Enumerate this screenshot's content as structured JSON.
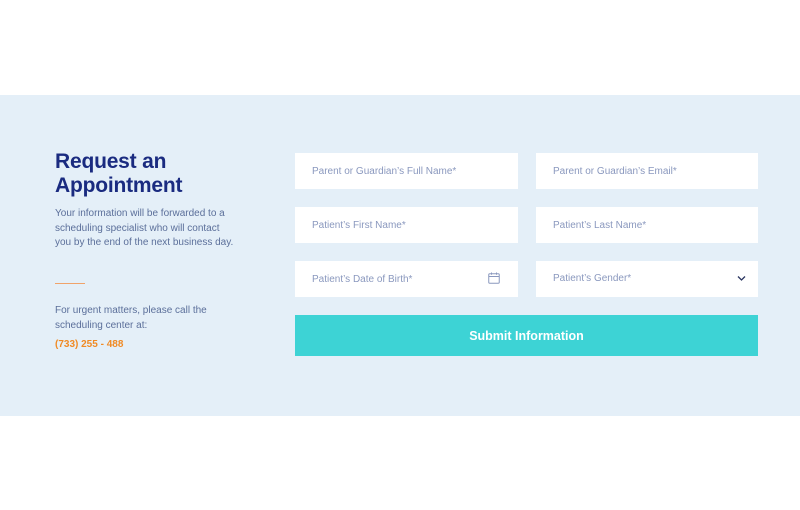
{
  "intro": {
    "title_line1": "Request an",
    "title_line2": "Appointment",
    "description": "Your information will be forwarded to a scheduling specialist who will contact you by the end of the next business day.",
    "urgent_text": "For urgent matters, please call the scheduling center at:",
    "phone": "(733) 255 - 488"
  },
  "form": {
    "guardian_name_placeholder": "Parent or Guardian’s Full Name*",
    "guardian_email_placeholder": "Parent or Guardian’s Email*",
    "patient_first_name_placeholder": "Patient’s First Name*",
    "patient_last_name_placeholder": "Patient’s Last Name*",
    "patient_dob_placeholder": "Patient’s Date of Birth*",
    "patient_gender_label": "Patient’s Gender*",
    "submit_label": "Submit Information"
  },
  "icons": {
    "date_field": "calendar-icon",
    "gender_field": "chevron-down-icon"
  },
  "colors": {
    "band_background": "#e4eff8",
    "title": "#1a2b80",
    "body_text": "#5b6f9a",
    "phone": "#f08a24",
    "divider": "#f0a36a",
    "submit_button": "#3dd3d5",
    "placeholder": "#8a98be"
  }
}
